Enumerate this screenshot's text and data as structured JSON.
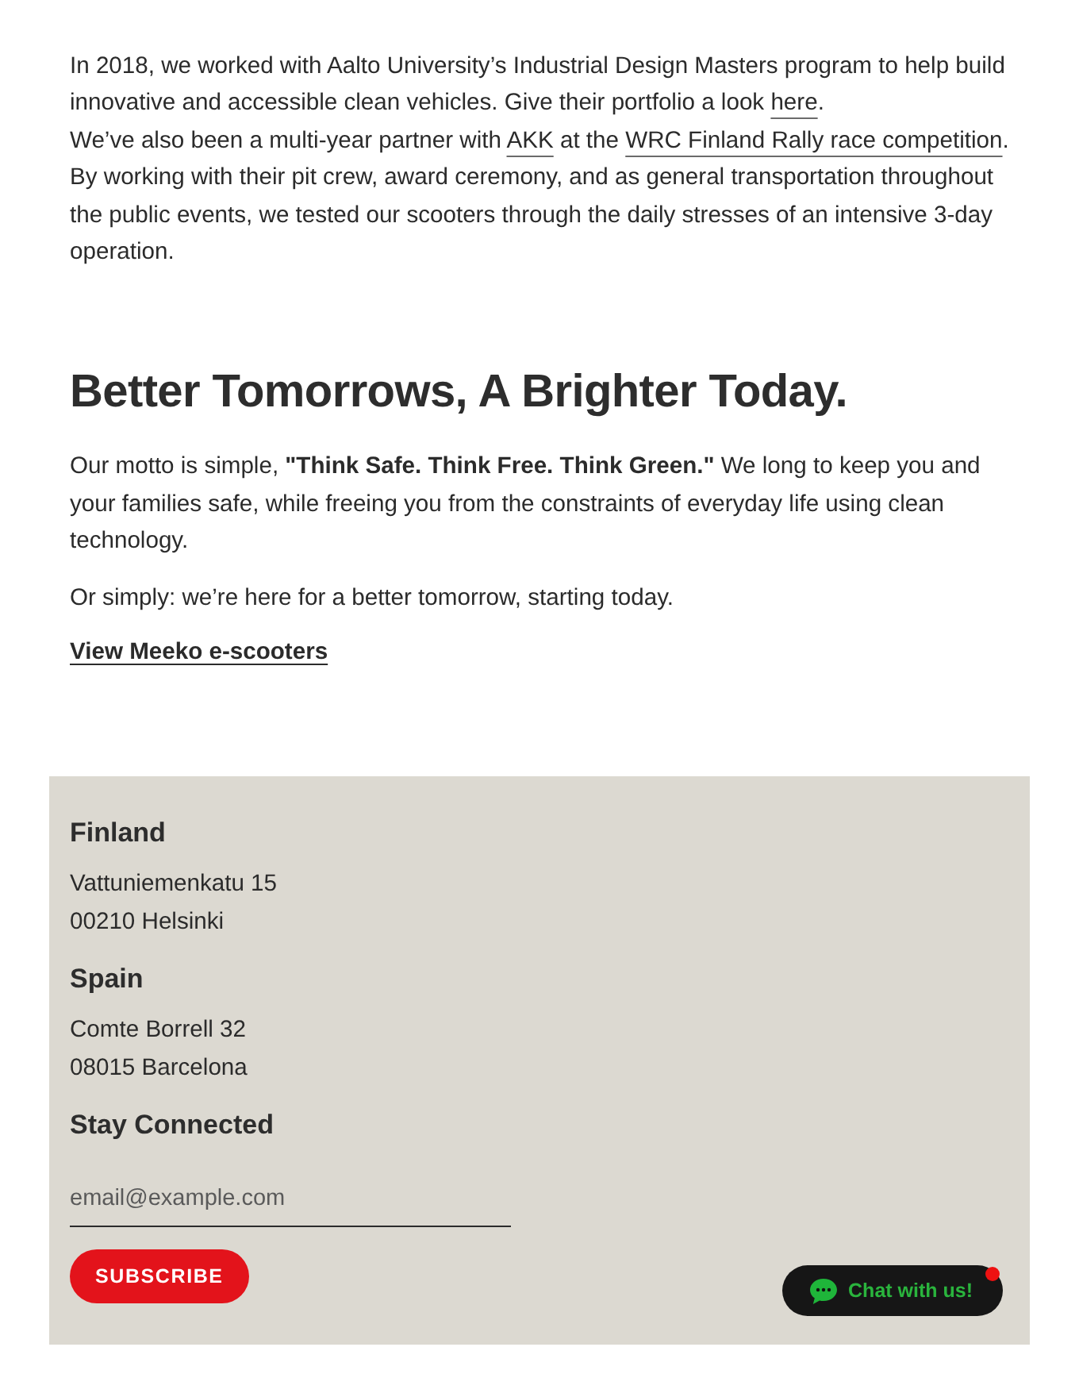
{
  "intro": {
    "segments": [
      {
        "kind": "text",
        "text": "In 2018, we worked with Aalto University’s Industrial Design Masters program to help build innovative and accessible clean vehicles. Give their portfolio a look "
      },
      {
        "kind": "link",
        "text": "here"
      },
      {
        "kind": "text",
        "text": "."
      },
      {
        "kind": "break"
      },
      {
        "kind": "text",
        "text": "We’ve also been a multi-year partner with "
      },
      {
        "kind": "link",
        "text": "AKK"
      },
      {
        "kind": "text",
        "text": " at the "
      },
      {
        "kind": "link",
        "text": "WRC Finland Rally race competition"
      },
      {
        "kind": "text",
        "text": ". By working with their pit crew, award ceremony, and as general transportation throughout the public events, we tested our scooters through the daily stresses of an intensive 3-day operation."
      }
    ]
  },
  "section": {
    "heading": "Better Tomorrows, A Brighter Today.",
    "paragraphs": [
      "Our motto is simple, **\"Think Safe. Think Free. Think Green.\"** We long to keep you and your families safe, while freeing you from the constraints of everyday life using clean technology.",
      "Or simply: we’re here for a better tomorrow, starting today."
    ],
    "link": "View Meeko e-scooters"
  },
  "footer": {
    "offices": [
      {
        "country": "Finland",
        "lines": [
          "Vattuniemenkatu 15",
          "00210 Helsinki"
        ]
      },
      {
        "country": "Spain",
        "lines": [
          "Comte Borrell 32",
          "08015 Barcelona"
        ]
      }
    ],
    "newsletter": {
      "title": "Stay Connected",
      "email": {
        "placeholder": "email@example.com"
      },
      "button": "SUBSCRIBE"
    }
  },
  "chat": {
    "label": "Chat with us!"
  }
}
